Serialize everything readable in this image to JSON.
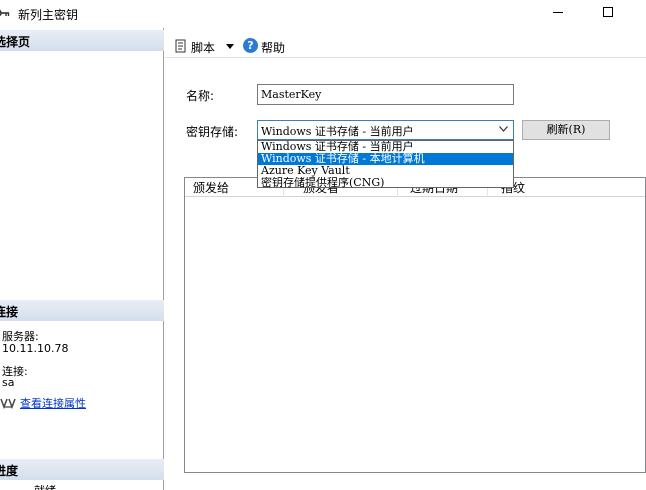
{
  "window": {
    "title": "新列主密钥"
  },
  "sidebar": {
    "select_page_header": "选择页",
    "connection_header": "连接",
    "server_label": "服务器:",
    "server_value": "10.11.10.78",
    "connection_label": "连接:",
    "connection_value": "sa",
    "view_connection_properties": "查看连接属性",
    "progress_header": "进度",
    "progress_status_partial": "就绪"
  },
  "toolbar": {
    "script_label": "脚本",
    "help_label": "帮助"
  },
  "form": {
    "name_label": "名称:",
    "name_value": "MasterKey",
    "key_store_label": "密钥存储:",
    "key_store_selected": "Windows 证书存储 - 当前用户",
    "refresh_button": "刷新(R)",
    "key_store_options": [
      "Windows 证书存储 - 当前用户",
      "Windows 证书存储 - 本地计算机",
      "Azure Key Vault",
      "密钥存储提供程序(CNG)"
    ],
    "highlighted_option_index": 1
  },
  "grid": {
    "columns": [
      "颁发给",
      "颁发者",
      "过期日期",
      "指纹"
    ]
  },
  "colors": {
    "selection": "#0078d7",
    "section_header": "#d4deec",
    "link": "#0033cc"
  }
}
